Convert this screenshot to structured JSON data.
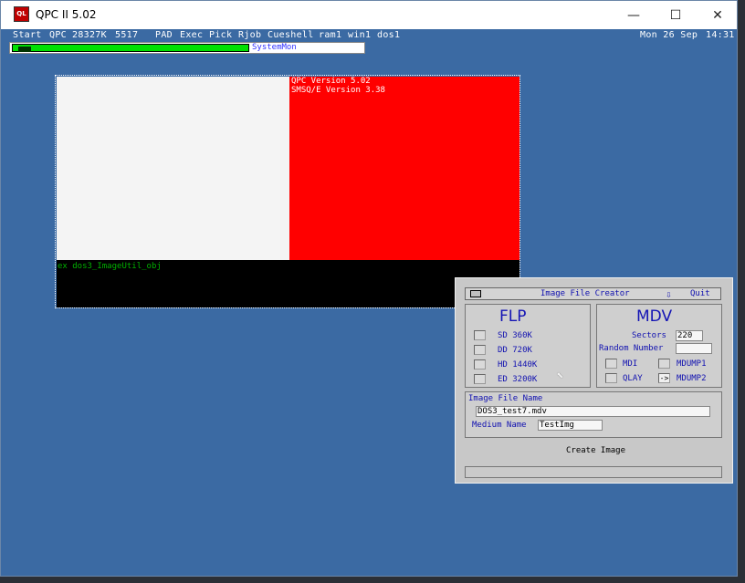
{
  "window": {
    "title": "QPC II 5.02",
    "icon_text": "QL",
    "controls": [
      "—",
      "☐",
      "✕"
    ]
  },
  "menubar": {
    "items": [
      "Start",
      "QPC",
      "28327K",
      "5517",
      "PAD",
      "Exec",
      "Pick",
      "Rjob",
      "Cueshell",
      "ram1",
      "win1",
      "dos1"
    ],
    "date": "Mon 26 Sep",
    "time": "14:31"
  },
  "sysbar": {
    "label": "SystemMon"
  },
  "console": {
    "lines": [
      "QPC Version 5.02",
      "SMSQ/E Version 3.38"
    ],
    "command": "ex dos3_ImageUtil_obj"
  },
  "dialog": {
    "title": "Image File Creator",
    "quit": "Quit",
    "flp": {
      "heading": "FLP",
      "options": [
        "SD  360K",
        "DD  720K",
        "HD  1440K",
        "ED  3200K"
      ]
    },
    "mdv": {
      "heading": "MDV",
      "sectors_label": "Sectors",
      "sectors_value": "220",
      "random_label": "Random Number",
      "random_value": "",
      "options": [
        "MDI",
        "MDUMP1",
        "QLAY",
        "MDUMP2"
      ],
      "selected_marker": "->"
    },
    "image": {
      "label": "Image File Name",
      "filename": "DOS3_test7.mdv",
      "medium_label": "Medium Name",
      "medium_value": "TestImg"
    },
    "create": "Create Image",
    "status": ""
  }
}
